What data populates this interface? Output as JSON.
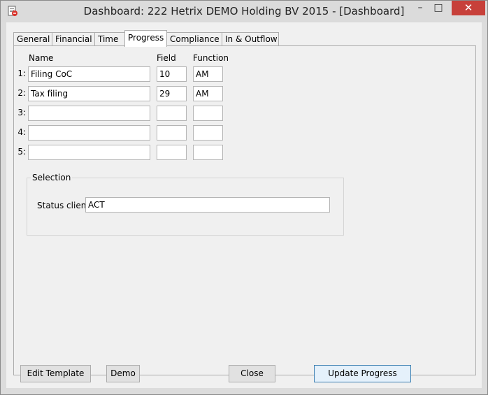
{
  "window": {
    "title": "Dashboard: 222 Hetrix DEMO Holding BV 2015 - [Dashboard]",
    "controls": {
      "minimize": "–",
      "maximize": "□",
      "close": "✕"
    }
  },
  "tabs": [
    "General",
    "Financial",
    "Time",
    "Progress",
    "Compliance",
    "In & Outflow"
  ],
  "active_tab": "Progress",
  "progress": {
    "headers": {
      "name": "Name",
      "field": "Field",
      "function": "Function"
    },
    "rows": [
      {
        "num": "1:",
        "name": "Filing CoC",
        "field": "10",
        "function": "AM"
      },
      {
        "num": "2:",
        "name": "Tax filing",
        "field": "29",
        "function": "AM"
      },
      {
        "num": "3:",
        "name": "",
        "field": "",
        "function": ""
      },
      {
        "num": "4:",
        "name": "",
        "field": "",
        "function": ""
      },
      {
        "num": "5:",
        "name": "",
        "field": "",
        "function": ""
      }
    ]
  },
  "selection": {
    "label": "Selection",
    "status_label": "Status client",
    "status_value": "ACT"
  },
  "buttons": {
    "edit_template": "Edit Template",
    "demo": "Demo",
    "close": "Close",
    "update_progress": "Update Progress"
  },
  "icons": {
    "app": "dashboard-app-icon"
  }
}
